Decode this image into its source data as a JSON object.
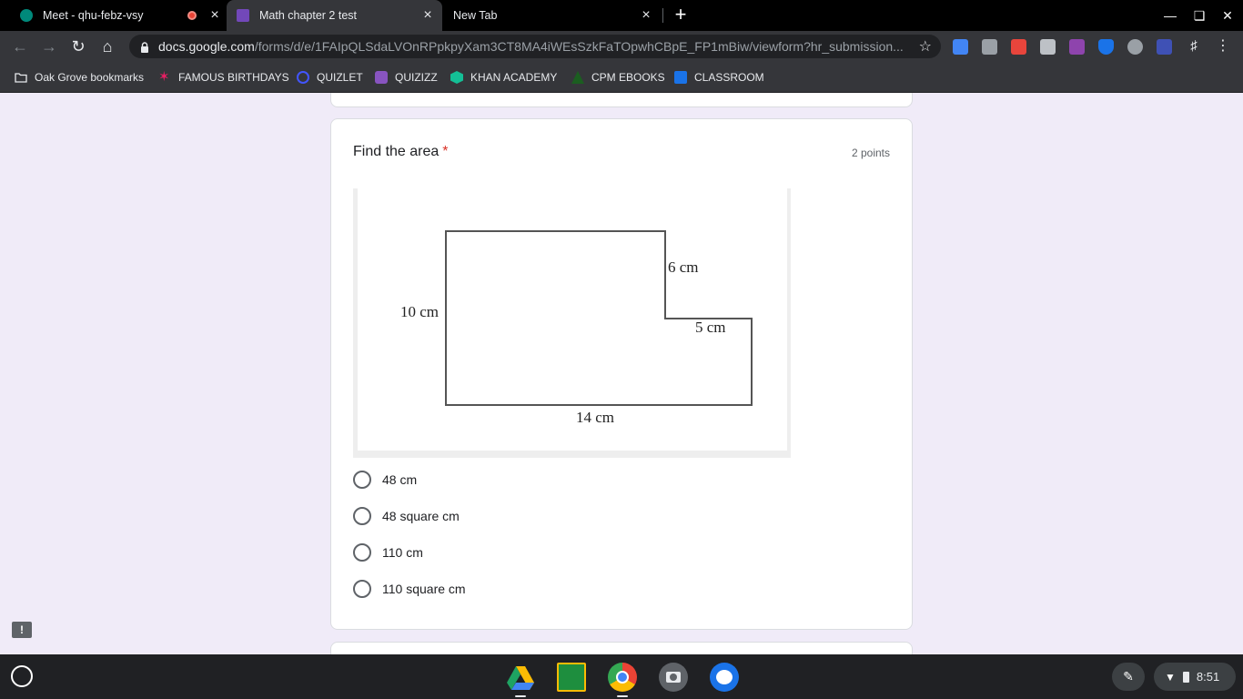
{
  "browser": {
    "tabs": [
      {
        "title": "Meet - qhu-febz-vsy",
        "favicon_color": "#00897b",
        "recording": true,
        "active": false
      },
      {
        "title": "Math chapter 2 test",
        "favicon_color": "#7248b9",
        "active": true
      },
      {
        "title": "New Tab",
        "active": false
      }
    ],
    "new_tab_glyph": "+",
    "close_glyph": "×",
    "url_host": "docs.google.com",
    "url_path": "/forms/d/e/1FAIpQLSdaLVOnRPpkpyXam3CT8MA4iWEsSzkFaTOpwhCBpE_FP1mBiw/viewform?hr_submission..."
  },
  "bookmarks": [
    {
      "label": "Oak Grove bookmarks",
      "icon": "folder-icon"
    },
    {
      "label": "FAMOUS BIRTHDAYS",
      "icon": "famous-birthdays-icon"
    },
    {
      "label": "QUIZLET",
      "icon": "quizlet-icon"
    },
    {
      "label": "QUIZIZZ",
      "icon": "quizizz-icon"
    },
    {
      "label": "KHAN ACADEMY",
      "icon": "khan-academy-icon"
    },
    {
      "label": "CPM EBOOKS",
      "icon": "cpm-icon"
    },
    {
      "label": "CLASSROOM",
      "icon": "classroom-icon"
    }
  ],
  "question": {
    "title": "Find the area",
    "required_mark": "*",
    "points": "2 points",
    "figure_labels": {
      "top_right": "6 cm",
      "left": "10 cm",
      "step": "5 cm",
      "bottom": "14 cm"
    },
    "options": [
      "48 cm",
      "48 square cm",
      "110 cm",
      "110 square cm"
    ]
  },
  "feedback_glyph": "!",
  "shelf": {
    "time": "8:51",
    "apps": [
      "google-drive-icon",
      "google-classroom-icon",
      "chrome-icon",
      "camera-icon",
      "canvas-icon"
    ]
  },
  "colors": {
    "page_bg": "#f0ebf8",
    "required": "#d93025",
    "forms_purple": "#7248b9"
  }
}
